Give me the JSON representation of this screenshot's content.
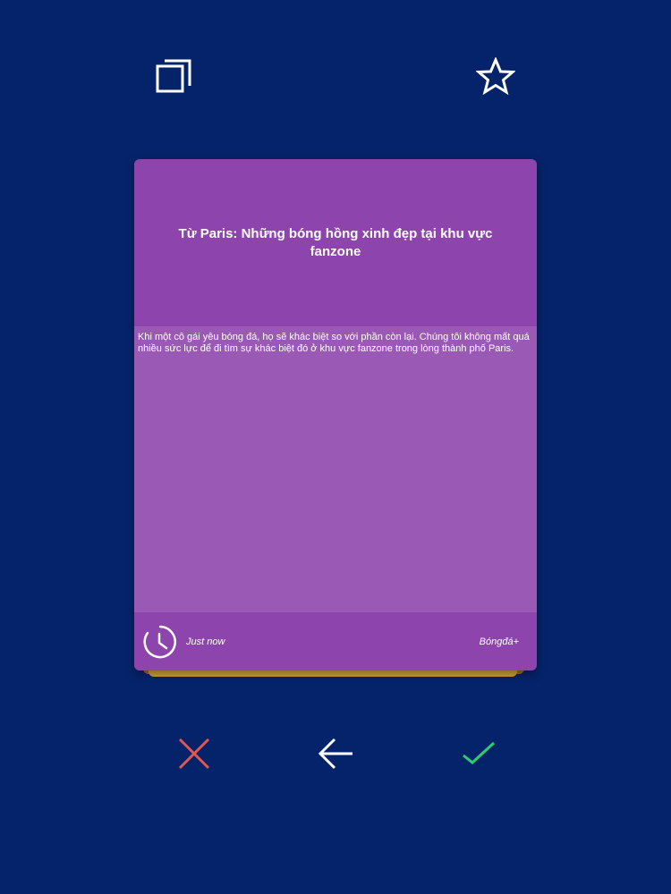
{
  "toolbar": {
    "copy_icon": "copy-icon",
    "favorite_icon": "star-icon"
  },
  "card": {
    "title": "Từ Paris: Những bóng hồng xinh đẹp tại khu vực fanzone",
    "description": "Khi một cô gái yêu bóng đá, họ sẽ khác biệt so với phần còn lại. Chúng tôi không mất quá nhiều sức lực để đi tìm sự khác biệt đó ở khu vực fanzone trong lòng thành phố Paris.",
    "time": "Just now",
    "source": "Bóngđá+",
    "colors": {
      "header": "#8e44ad",
      "body": "#9b59b6"
    }
  },
  "actions": {
    "reject_icon": "close-icon",
    "back_icon": "arrow-left-icon",
    "accept_icon": "check-icon",
    "colors": {
      "reject": "#e0584f",
      "back": "#ffffff",
      "accept": "#2ecc71"
    }
  },
  "colors": {
    "background": "#05236a"
  }
}
